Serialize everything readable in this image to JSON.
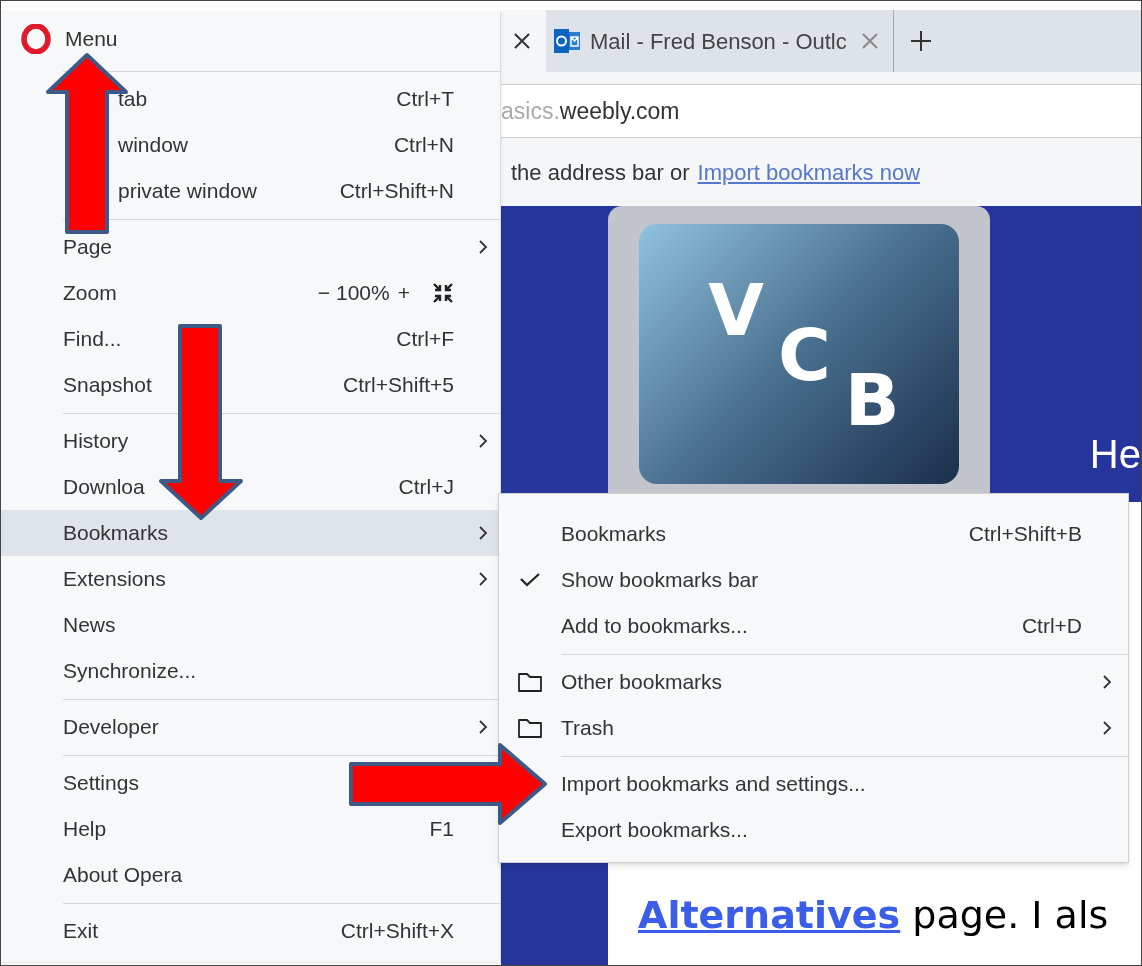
{
  "browser": {
    "tabs": [
      {
        "selected": true
      },
      {
        "title": "Mail - Fred Benson - Outlc",
        "selected": false
      }
    ],
    "address": {
      "faded": "asics.",
      "host": "weebly.com"
    },
    "bookmarks_hint": {
      "text": "the address bar or",
      "link": "Import bookmarks now"
    },
    "page": {
      "logo_letters": [
        "V",
        "C",
        "B"
      ],
      "heading": "He",
      "link": "Alternatives",
      "text": "page.  I als"
    }
  },
  "menu": {
    "title": "Menu",
    "items": [
      {
        "kind": "item",
        "label": "tab",
        "shortcut": "Ctrl+T",
        "submenu": false,
        "selected": false
      },
      {
        "kind": "item",
        "label": "window",
        "shortcut": "Ctrl+N",
        "submenu": false,
        "selected": false
      },
      {
        "kind": "item",
        "label": "private window",
        "shortcut": "Ctrl+Shift+N",
        "submenu": false,
        "selected": false
      },
      {
        "kind": "separator"
      },
      {
        "kind": "item",
        "label": "Page",
        "submenu": true,
        "selected": false
      },
      {
        "kind": "zoom",
        "label": "Zoom",
        "minus": "−",
        "value": "100%",
        "plus": "+",
        "selected": false
      },
      {
        "kind": "item",
        "label": "Find...",
        "shortcut": "Ctrl+F",
        "submenu": false,
        "selected": false
      },
      {
        "kind": "item",
        "label": "Snapshot",
        "shortcut": "Ctrl+Shift+5",
        "submenu": false,
        "selected": false
      },
      {
        "kind": "separator"
      },
      {
        "kind": "item",
        "label": "History",
        "submenu": true,
        "selected": false
      },
      {
        "kind": "item",
        "label": "Downloa",
        "shortcut": "Ctrl+J",
        "submenu": false,
        "selected": false
      },
      {
        "kind": "item",
        "label": "Bookmarks",
        "submenu": true,
        "selected": true
      },
      {
        "kind": "item",
        "label": "Extensions",
        "submenu": true,
        "selected": false
      },
      {
        "kind": "item",
        "label": "News",
        "submenu": false,
        "selected": false
      },
      {
        "kind": "item",
        "label": "Synchronize...",
        "submenu": false,
        "selected": false
      },
      {
        "kind": "separator"
      },
      {
        "kind": "item",
        "label": "Developer",
        "submenu": true,
        "selected": false
      },
      {
        "kind": "separator"
      },
      {
        "kind": "item",
        "label": "Settings",
        "selected": false
      },
      {
        "kind": "item",
        "label": "Help",
        "shortcut": "F1",
        "submenu": false,
        "selected": false
      },
      {
        "kind": "item",
        "label": "About Opera",
        "submenu": false,
        "selected": false
      },
      {
        "kind": "separator"
      },
      {
        "kind": "item",
        "label": "Exit",
        "shortcut": "Ctrl+Shift+X",
        "submenu": false,
        "selected": false
      }
    ]
  },
  "submenu": {
    "items": [
      {
        "kind": "action",
        "label": "Bookmarks",
        "shortcut": "Ctrl+Shift+B",
        "checked": false,
        "submenu": false
      },
      {
        "kind": "action",
        "label": "Show bookmarks bar",
        "checked": true,
        "submenu": false
      },
      {
        "kind": "action",
        "label": "Add to bookmarks...",
        "shortcut": "Ctrl+D",
        "checked": false,
        "submenu": false
      },
      {
        "kind": "separator"
      },
      {
        "kind": "folder",
        "label": "Other bookmarks",
        "checked": false,
        "submenu": true
      },
      {
        "kind": "folder",
        "label": "Trash",
        "checked": false,
        "submenu": true
      },
      {
        "kind": "separator"
      },
      {
        "kind": "action",
        "label": "Import bookmarks and settings...",
        "submenu": false
      },
      {
        "kind": "action",
        "label": "Export bookmarks...",
        "checked": false,
        "submenu": false
      }
    ]
  }
}
